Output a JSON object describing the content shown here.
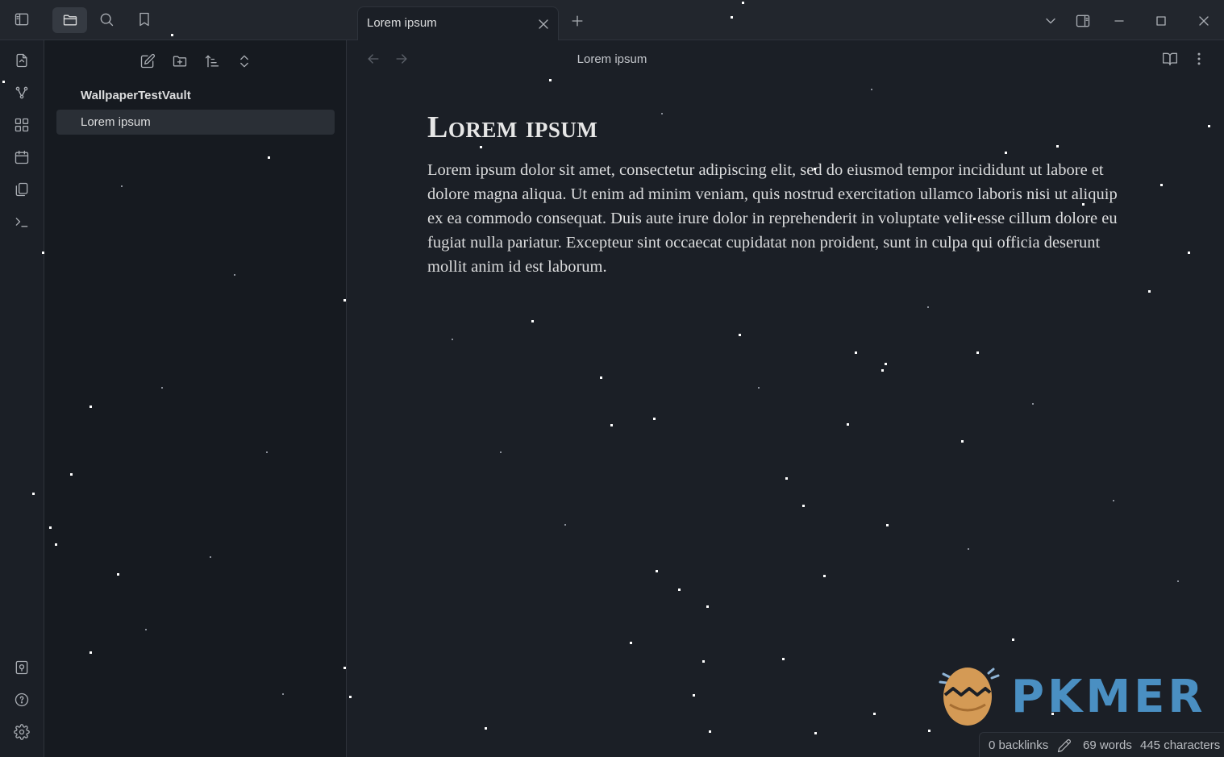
{
  "ribbon_top": {
    "icons": [
      "sidebar-toggle-icon",
      "folder-icon",
      "search-icon",
      "bookmark-icon"
    ]
  },
  "ribbon": {
    "top_icons": [
      "open-quick-switcher-icon",
      "graph-view-icon",
      "canvas-icon",
      "daily-note-icon",
      "templates-icon",
      "command-palette-icon"
    ],
    "bottom_icons": [
      "vault-switcher-icon",
      "help-icon",
      "settings-icon"
    ]
  },
  "sidebar": {
    "toolbar_icons": [
      "new-note-icon",
      "new-folder-icon",
      "sort-icon",
      "collapse-expand-icon"
    ],
    "vault_name": "WallpaperTestVault",
    "files": [
      {
        "label": "Lorem ipsum",
        "active": true
      }
    ]
  },
  "tabbar": {
    "tabs": [
      {
        "label": "Lorem ipsum",
        "active": true
      }
    ],
    "window_controls": [
      "tab-list-icon",
      "right-sidebar-toggle-icon",
      "minimize-icon",
      "maximize-icon",
      "close-window-icon"
    ]
  },
  "view_header": {
    "title": "Lorem ipsum",
    "nav_icons": [
      "back-arrow-icon",
      "forward-arrow-icon"
    ],
    "action_icons": [
      "reading-view-icon",
      "more-options-icon"
    ]
  },
  "note": {
    "heading": "Lorem ipsum",
    "body": "Lorem ipsum dolor sit amet, consectetur adipiscing elit, sed do eiusmod tempor incididunt ut labore et dolore magna aliqua. Ut enim ad minim veniam, quis nostrud exercitation ullamco laboris nisi ut aliquip ex ea commodo consequat. Duis aute irure dolor in reprehenderit in voluptate velit esse cillum dolore eu fugiat nulla pariatur. Excepteur sint occaecat cupidatat non proident, sunt in culpa qui officia deserunt mollit anim id est laborum."
  },
  "status_bar": {
    "backlinks": "0 backlinks",
    "words": "69 words",
    "characters": "445 characters"
  },
  "watermark": {
    "text": "PKMER"
  },
  "colors": {
    "background": "#1b1f26",
    "sidebar": "#161a20",
    "chrome": "#22262d",
    "accent_blue": "#4a8fc2",
    "logo_orange": "#d49a55"
  }
}
